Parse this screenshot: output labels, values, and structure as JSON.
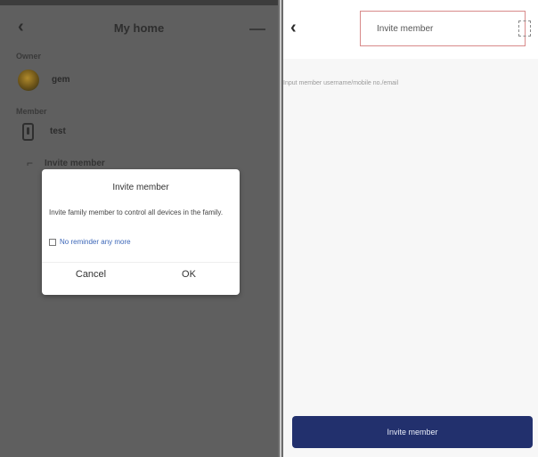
{
  "left_screen": {
    "title": "My home",
    "back_icon": "chevron-left-icon",
    "owner_label": "Owner",
    "owner_name": "gem",
    "member_label": "Member",
    "member_name": "test",
    "invite_row_label": "Invite member",
    "dialog": {
      "title": "Invite member",
      "body": "Invite family member to control all devices in the family.",
      "checkbox_label": "No reminder any more",
      "cancel_label": "Cancel",
      "ok_label": "OK"
    }
  },
  "right_screen": {
    "back_icon": "chevron-left-icon",
    "title": "Invite member",
    "scan_icon": "scan-icon",
    "hint_text": "Input member username/mobile no./email",
    "button_label": "Invite member",
    "button_color": "#22306d"
  }
}
